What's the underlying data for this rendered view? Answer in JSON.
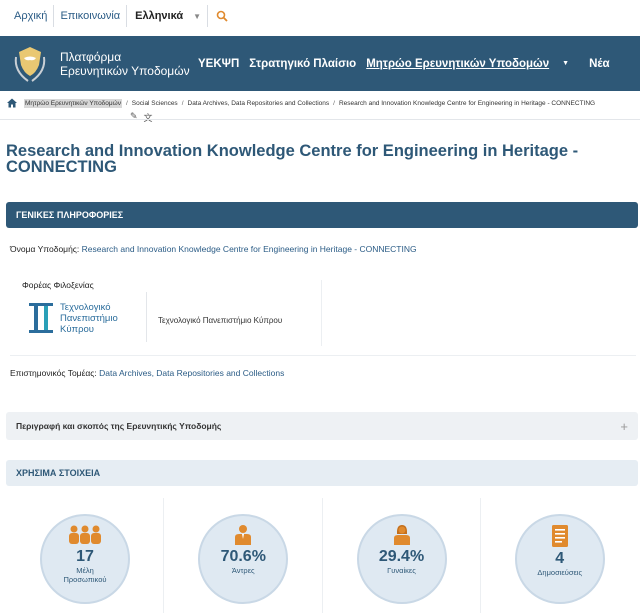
{
  "topbar": {
    "home_link": "Αρχική",
    "contact_link": "Επικοινωνία",
    "language": "Ελληνικά"
  },
  "navbar": {
    "brand_line1": "Πλατφόρμα",
    "brand_line2": "Ερευνητικών Υποδομών",
    "items": [
      {
        "label": "ΥΕΚΨΠ"
      },
      {
        "label": "Στρατηγικό Πλαίσιο"
      },
      {
        "label": "Μητρώο Ερευνητικών Υποδομών"
      },
      {
        "label": "Νέα"
      }
    ]
  },
  "breadcrumb": {
    "items": [
      "Μητρώο Ερευνητικών Υποδομών",
      "Social Sciences",
      "Data Archives, Data Repositories and Collections",
      "Research and Innovation Knowledge Centre for Engineering in Heritage - CONNECTING"
    ]
  },
  "page": {
    "title": "Research and Innovation Knowledge Centre for Engineering in Heritage - CONNECTING"
  },
  "general": {
    "heading": "ΓΕΝΙΚΕΣ ΠΛΗΡΟΦΟΡΙΕΣ",
    "name_label": "Όνομα Υποδομής:",
    "name_value": "Research and Innovation Knowledge Centre for Engineering in Heritage - CONNECTING",
    "host_label": "Φορέας Φιλοξενίας",
    "host_logo_line1": "Τεχνολογικό",
    "host_logo_line2": "Πανεπιστήμιο",
    "host_logo_line3": "Κύπρου",
    "host_name": "Τεχνολογικό Πανεπιστήμιο Κύπρου",
    "sector_label": "Επιστημονικός Τομέας:",
    "sector_value": "Data Archives, Data Repositories and Collections"
  },
  "description": {
    "heading": "Περιγραφή και σκοπός της Ερευνητικής Υποδομής"
  },
  "useful": {
    "heading": "ΧΡΗΣΙΜΑ ΣΤΟΙΧΕΙΑ",
    "stats": [
      {
        "value": "17",
        "label": "Μέλη Προσωπικού",
        "icon": "group-icon"
      },
      {
        "value": "70.6%",
        "label": "Άντρες",
        "icon": "man-icon"
      },
      {
        "value": "29.4%",
        "label": "Γυναίκες",
        "icon": "woman-icon"
      },
      {
        "value": "4",
        "label": "Δημοσιεύσεις",
        "icon": "document-icon"
      }
    ]
  },
  "colors": {
    "primary": "#2e5877",
    "accent": "#e08a2e",
    "link": "#2b5c86"
  }
}
